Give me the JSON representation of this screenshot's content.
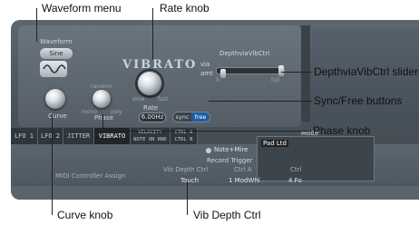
{
  "callouts": {
    "waveform_menu": "Waveform menu",
    "rate_knob": "Rate knob",
    "depth_sliders": "DepthviaVibCtrl sliders",
    "sync_free": "Sync/Free buttons",
    "phase_knob": "Phase knob",
    "curve_knob": "Curve knob",
    "vib_depth_ctrl": "Vib Depth Ctrl"
  },
  "module": {
    "title": "VIBRATO",
    "waveform_label": "Waveform",
    "waveform_value": "Sine",
    "curve_label": "Curve",
    "phase_label": "Phase",
    "phase_random": "random",
    "phase_mono": "mono",
    "phase_poly": "poly",
    "rate_label": "Rate",
    "rate_slow": "slow",
    "rate_fast": "fast",
    "rate_value": "6.00Hz",
    "sync_label": "sync",
    "free_label": "free",
    "depth_label": "DepthviaVibCtrl",
    "via_label": "via",
    "amt_label": "amt",
    "slider_min": "0",
    "slider_max": "full",
    "depth_via_level": 0.97,
    "depth_amt_level": 0.05
  },
  "tabs": [
    {
      "label": "LFO 1"
    },
    {
      "label": "LFO 2"
    },
    {
      "label": "JITTER"
    },
    {
      "label": "VIBRATO"
    },
    {
      "label_top": "VELOCITY",
      "label_bottom": "NOTE ON RND"
    },
    {
      "label_top": "CTRL A",
      "label_bottom": "CTRL B"
    }
  ],
  "lower": {
    "note_mire": "Note+Mire",
    "record_trigger": "Record Trigger",
    "mode_label": "Mode",
    "pad_label": "Pad Ltd"
  },
  "bottom": {
    "midi_assign": "MIDI Controller Assign",
    "vib_depth_ctrl_label": "Vib Depth Ctrl",
    "vib_depth_ctrl_value": "Touch",
    "ctrl_a_label": "Ctrl A",
    "ctrl_a_value": "1 ModWhl",
    "ctrl_b_label": "Ctrl",
    "ctrl_b_value": "4 Fo"
  }
}
